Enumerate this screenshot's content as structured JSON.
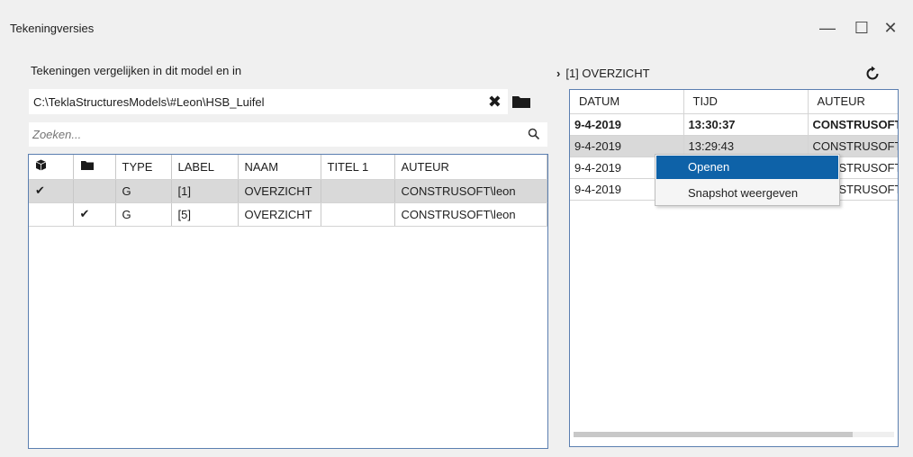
{
  "window": {
    "title": "Tekeningversies",
    "minimize_glyph": "—",
    "maximize_glyph": "☐",
    "close_glyph": "✕"
  },
  "left": {
    "compare_label": "Tekeningen vergelijken in dit model en in",
    "path_value": "C:\\TeklaStructuresModels\\#Leon\\HSB_Luifel",
    "clear_icon": "close-icon",
    "folder_icon": "folder-icon",
    "search_placeholder": "Zoeken...",
    "search_icon": "search-icon",
    "grid": {
      "columns": {
        "col1_icon": "cube-icon",
        "col2_icon": "folder-icon",
        "type": "TYPE",
        "label": "LABEL",
        "naam": "NAAM",
        "titel": "TITEL 1",
        "auteur": "AUTEUR"
      },
      "rows": [
        {
          "c1": "✔",
          "c2": "",
          "type": "G",
          "label": "[1]",
          "naam": "OVERZICHT",
          "titel": "",
          "auteur": "CONSTRUSOFT\\leon",
          "selected": true
        },
        {
          "c1": "",
          "c2": "✔",
          "type": "G",
          "label": "[5]",
          "naam": "OVERZICHT",
          "titel": "",
          "auteur": "CONSTRUSOFT\\leon",
          "selected": false
        }
      ]
    }
  },
  "right": {
    "header_chevron": "›",
    "header_title": "[1] OVERZICHT",
    "refresh_icon": "refresh-icon",
    "grid": {
      "columns": {
        "datum": "DATUM",
        "tijd": "TIJD",
        "auteur": "AUTEUR"
      },
      "rows": [
        {
          "datum": "9-4-2019",
          "tijd": "13:30:37",
          "auteur": "CONSTRUSOFT",
          "bold": true
        },
        {
          "datum": "9-4-2019",
          "tijd": "13:29:43",
          "auteur": "CONSTRUSOFT",
          "bold": false
        },
        {
          "datum": "9-4-2019",
          "tijd": "",
          "auteur": "CONSTRUSOFT",
          "bold": false
        },
        {
          "datum": "9-4-2019",
          "tijd": "",
          "auteur": "CONSTRUSOFT",
          "bold": false
        }
      ]
    }
  },
  "context_menu": {
    "items": [
      {
        "label": "Openen",
        "active": true
      },
      {
        "label": "Snapshot weergeven",
        "active": false
      }
    ]
  },
  "colors": {
    "menu_highlight": "#0e62a8",
    "grid_border": "#5b7fb0",
    "selected_row": "#d9d9d9"
  }
}
